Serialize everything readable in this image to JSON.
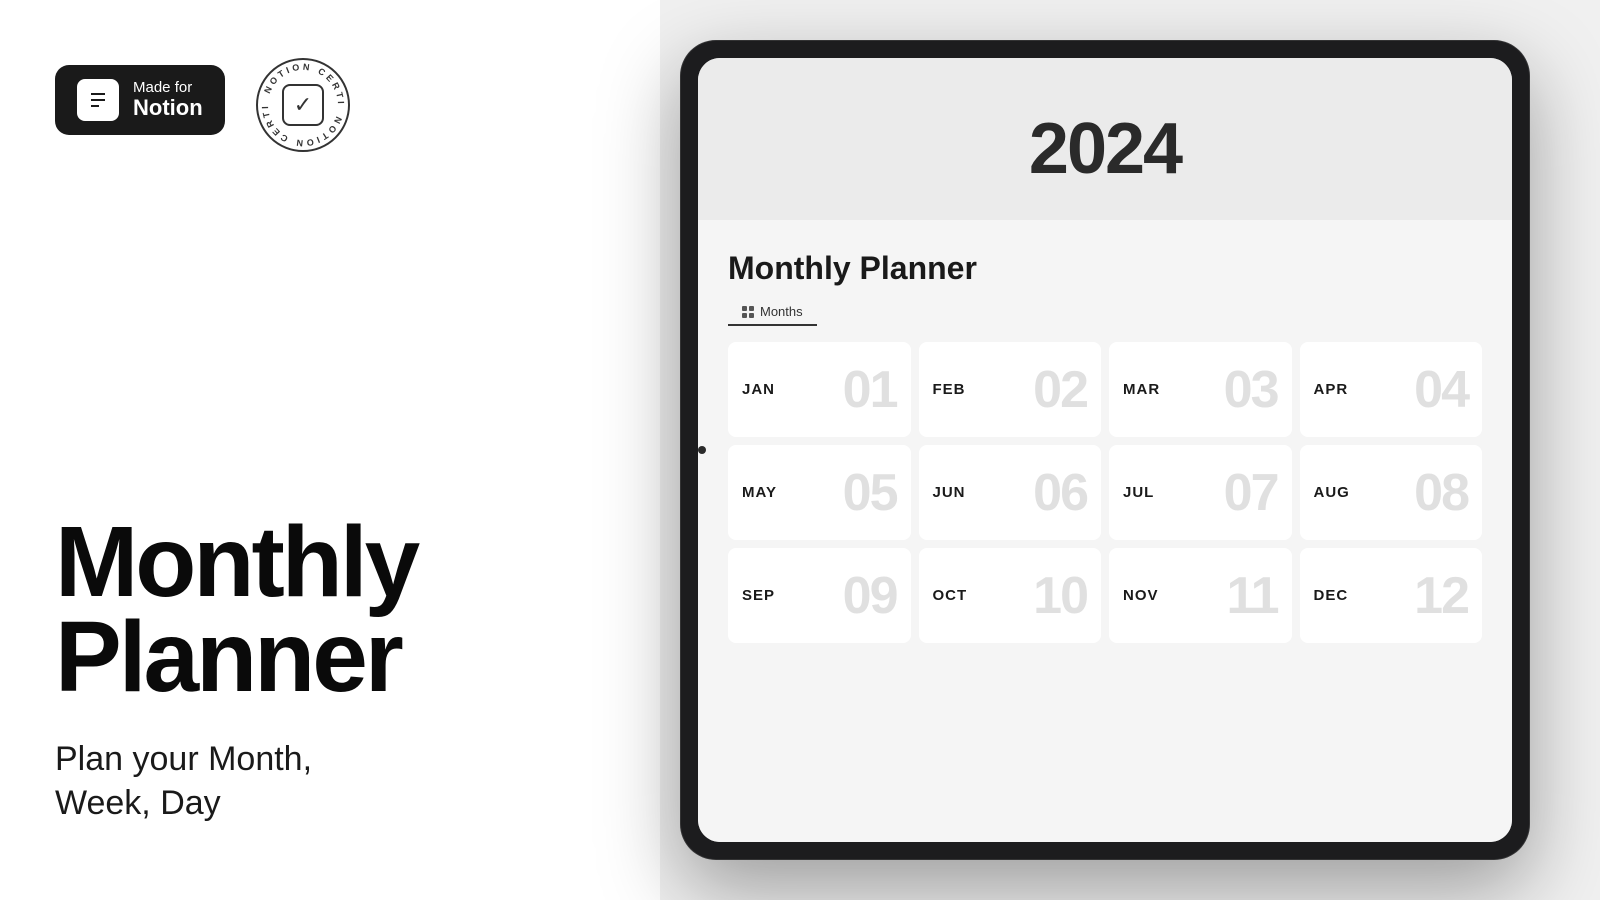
{
  "left": {
    "badge": {
      "made_for": "Made for",
      "notion": "Notion"
    },
    "certified": {
      "top_text": "NOTION CERTIFIED",
      "bottom_text": "NOTION CERTIFIED"
    },
    "title_line1": "Monthly",
    "title_line2": "Planner",
    "subtitle": "Plan your Month,\nWeek, Day"
  },
  "tablet": {
    "year": "2024",
    "section_title": "Monthly Planner",
    "tab_label": "Months",
    "months": [
      {
        "name": "JAN",
        "number": "01"
      },
      {
        "name": "FEB",
        "number": "02"
      },
      {
        "name": "MAR",
        "number": "03"
      },
      {
        "name": "APR",
        "number": "04"
      },
      {
        "name": "MAY",
        "number": "05"
      },
      {
        "name": "JUN",
        "number": "06"
      },
      {
        "name": "JUL",
        "number": "07"
      },
      {
        "name": "AUG",
        "number": "08"
      },
      {
        "name": "SEP",
        "number": "09"
      },
      {
        "name": "OCT",
        "number": "10"
      },
      {
        "name": "NOV",
        "number": "11"
      },
      {
        "name": "DEC",
        "number": "12"
      }
    ]
  }
}
